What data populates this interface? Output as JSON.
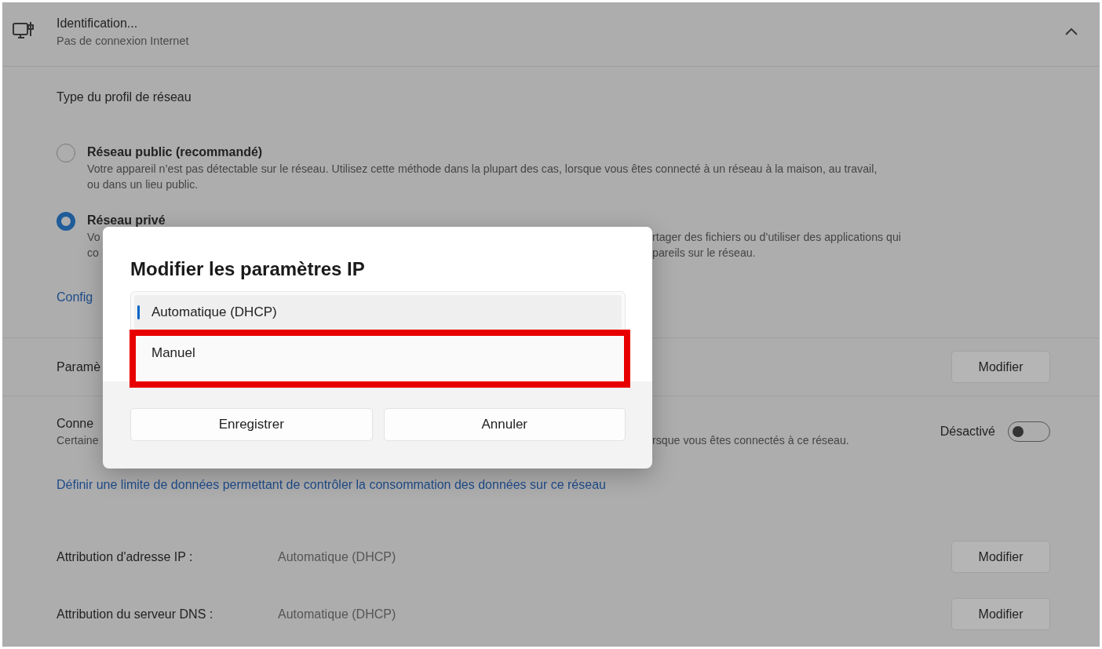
{
  "header": {
    "title": "Identification...",
    "subtitle": "Pas de connexion Internet",
    "expanded": true
  },
  "profile": {
    "heading": "Type du profil de réseau",
    "options": [
      {
        "title": "Réseau public (recommandé)",
        "description_lines": [
          {
            "start": "Votre appareil n’est pas détectable sur le réseau. Utilisez cette méthode dans la plupart des cas, lorsque vous êtes connecté à un réseau à la maison, au travail,"
          },
          {
            "start": "ou dans un lieu public."
          }
        ],
        "selected": false
      },
      {
        "title": "Réseau privé",
        "description_lines": [
          {
            "start": "Vo",
            "end": "rtager des fichiers ou d’utiliser des applications qui"
          },
          {
            "start": "co",
            "end": "pareils sur le réseau."
          }
        ],
        "selected": true
      }
    ]
  },
  "config_link": "Config",
  "firewall_row": {
    "label": "Paramè",
    "button": "Modifier"
  },
  "metered_row": {
    "label": "Conne",
    "description_start": "Certaine",
    "description_end": "rsque vous êtes connectés à ce réseau.",
    "state_label": "Désactivé",
    "on": false
  },
  "data_limit_link": "Définir une limite de données permettant de contrôler la consommation des données sur ce réseau",
  "ip_rows": [
    {
      "label": "Attribution d'adresse IP :",
      "value": "Automatique (DHCP)",
      "button": "Modifier"
    },
    {
      "label": "Attribution du serveur DNS :",
      "value": "Automatique (DHCP)",
      "button": "Modifier"
    }
  ],
  "dialog": {
    "title": "Modifier les paramètres IP",
    "options": [
      {
        "label": "Automatique (DHCP)",
        "selected": true
      },
      {
        "label": "Manuel",
        "selected": false
      }
    ],
    "buttons": [
      "Enregistrer",
      "Annuler"
    ]
  }
}
